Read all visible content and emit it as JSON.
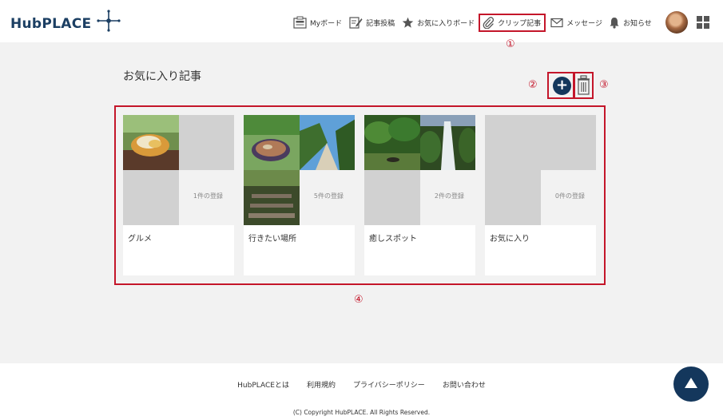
{
  "header": {
    "logo": "HubPLACE",
    "nav": [
      {
        "label": "Myボード",
        "icon": "board-icon"
      },
      {
        "label": "記事投稿",
        "icon": "pen-icon"
      },
      {
        "label": "お気に入りボード",
        "icon": "star-icon"
      },
      {
        "label": "クリップ記事",
        "icon": "paperclip-icon"
      },
      {
        "label": "メッセージ",
        "icon": "envelope-icon"
      },
      {
        "label": "お知らせ",
        "icon": "bell-icon"
      }
    ]
  },
  "markers": {
    "m1": "①",
    "m2": "②",
    "m3": "③",
    "m4": "④"
  },
  "page": {
    "title": "お気に入り記事"
  },
  "folders": [
    {
      "name": "グルメ",
      "count": "1件の登録"
    },
    {
      "name": "行きたい場所",
      "count": "5件の登録"
    },
    {
      "name": "癒しスポット",
      "count": "2件の登録"
    },
    {
      "name": "お気に入り",
      "count": "0件の登録"
    }
  ],
  "actions": {
    "add_symbol": "+"
  },
  "footer": {
    "links": [
      "HubPLACEとは",
      "利用規約",
      "プライバシーポリシー",
      "お問い合わせ"
    ],
    "copyright": "(C) Copyright HubPLACE. All Rights Reserved."
  },
  "colors": {
    "brand": "#14375c",
    "highlight": "#c4162a",
    "background": "#f2f2f2"
  }
}
